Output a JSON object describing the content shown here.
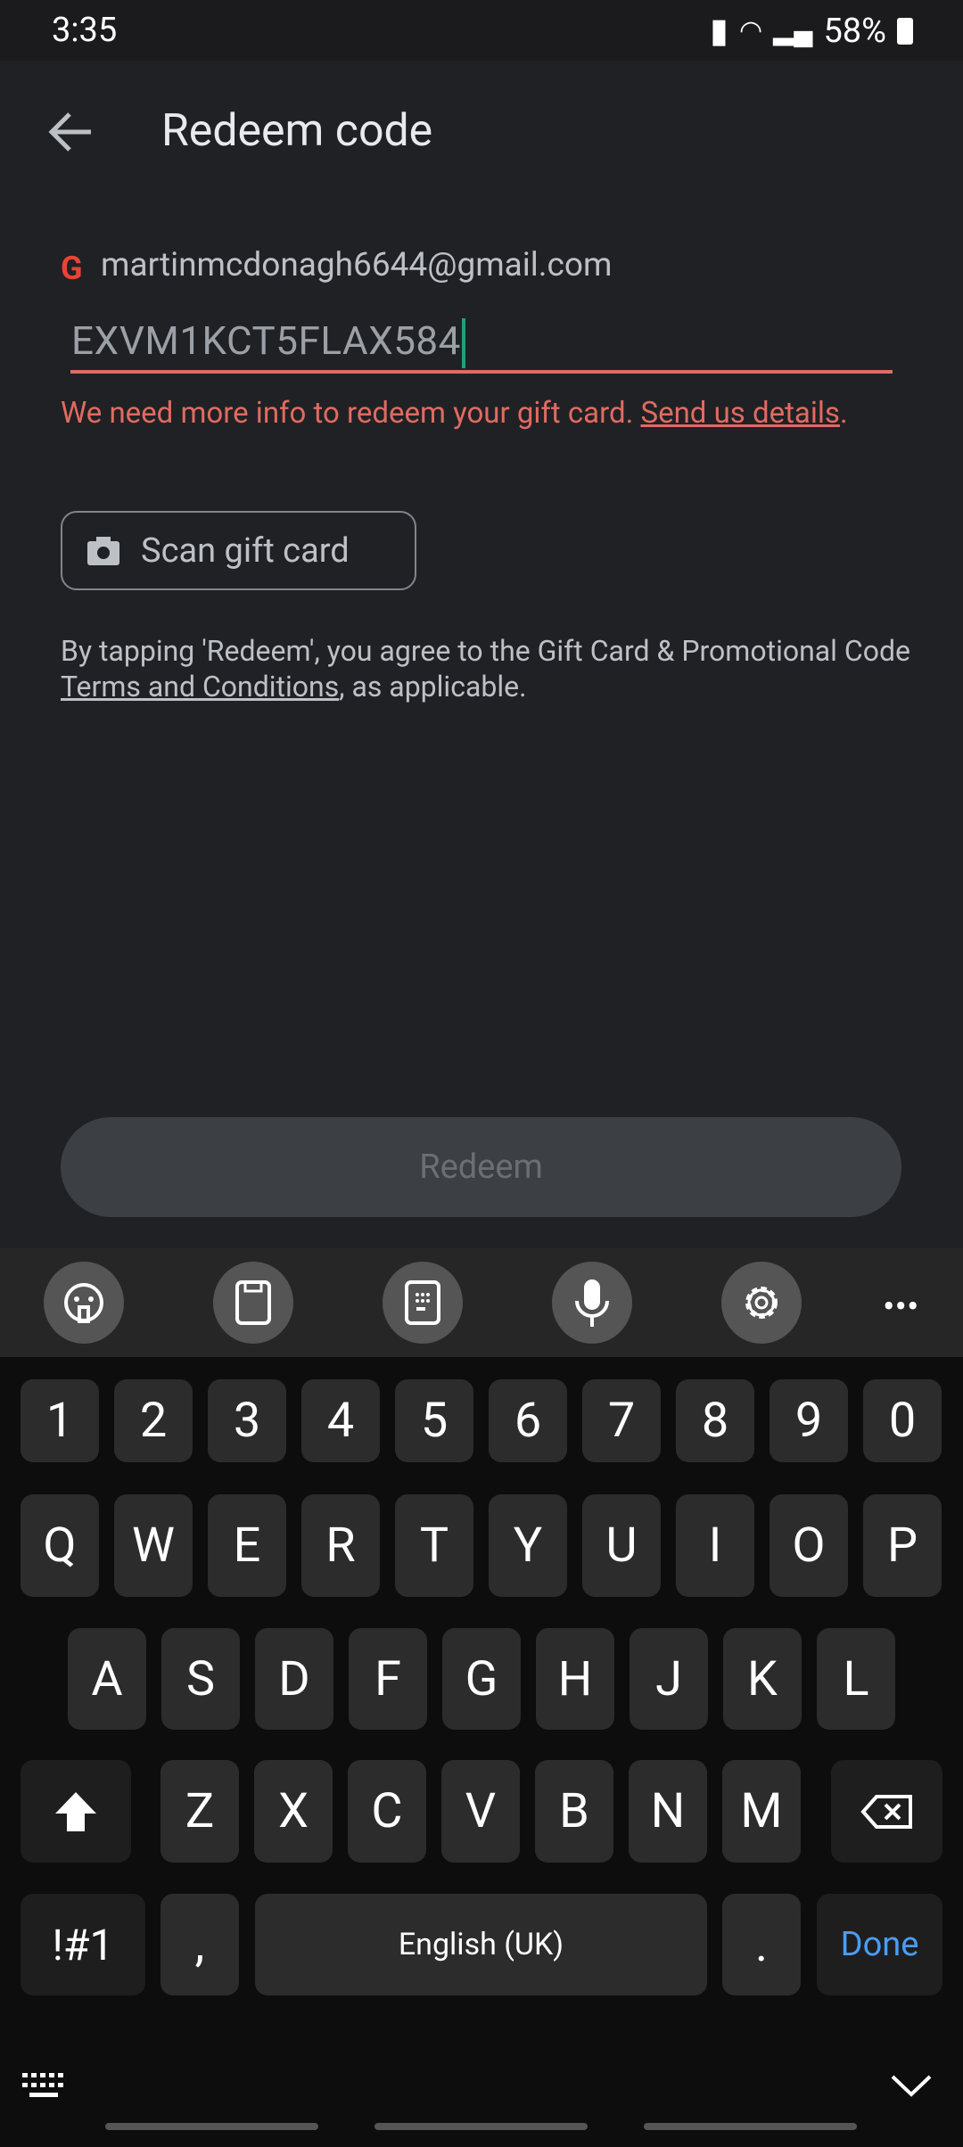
{
  "status": {
    "time": "3:35",
    "battery": "58%"
  },
  "header": {
    "title": "Redeem code",
    "back_icon": "arrow-left-icon"
  },
  "account": {
    "email": "martinmcdonagh6644@gmail.com",
    "icon": "google-g-icon"
  },
  "code_input": {
    "value": "EXVM1KCT5FLAX584"
  },
  "error": {
    "text": "We need more info to redeem your gift card. ",
    "link": "Send us details",
    "end": ".",
    "color": "#e06b61"
  },
  "scan_button": {
    "label": "Scan gift card",
    "icon": "camera-icon"
  },
  "terms": {
    "prefix": "By tapping 'Redeem', you agree to the Gift Card & Promotional Code ",
    "link": "Terms and Conditions",
    "suffix": ", as applicable."
  },
  "redeem_button": {
    "label": "Redeem"
  },
  "toolbar": {
    "icons": [
      "emoji-icon",
      "clipboard-icon",
      "keypad-icon",
      "microphone-icon",
      "settings-icon",
      "more-icon"
    ]
  },
  "keyboard": {
    "numbers": [
      "1",
      "2",
      "3",
      "4",
      "5",
      "6",
      "7",
      "8",
      "9",
      "0"
    ],
    "row1": [
      "Q",
      "W",
      "E",
      "R",
      "T",
      "Y",
      "U",
      "I",
      "O",
      "P"
    ],
    "row2": [
      "A",
      "S",
      "D",
      "F",
      "G",
      "H",
      "J",
      "K",
      "L"
    ],
    "row3": [
      "Z",
      "X",
      "C",
      "V",
      "B",
      "N",
      "M"
    ],
    "symbols": "!#1",
    "comma": ",",
    "space": "English (UK)",
    "period": ".",
    "done": "Done",
    "done_color": "#4b9cf5"
  }
}
